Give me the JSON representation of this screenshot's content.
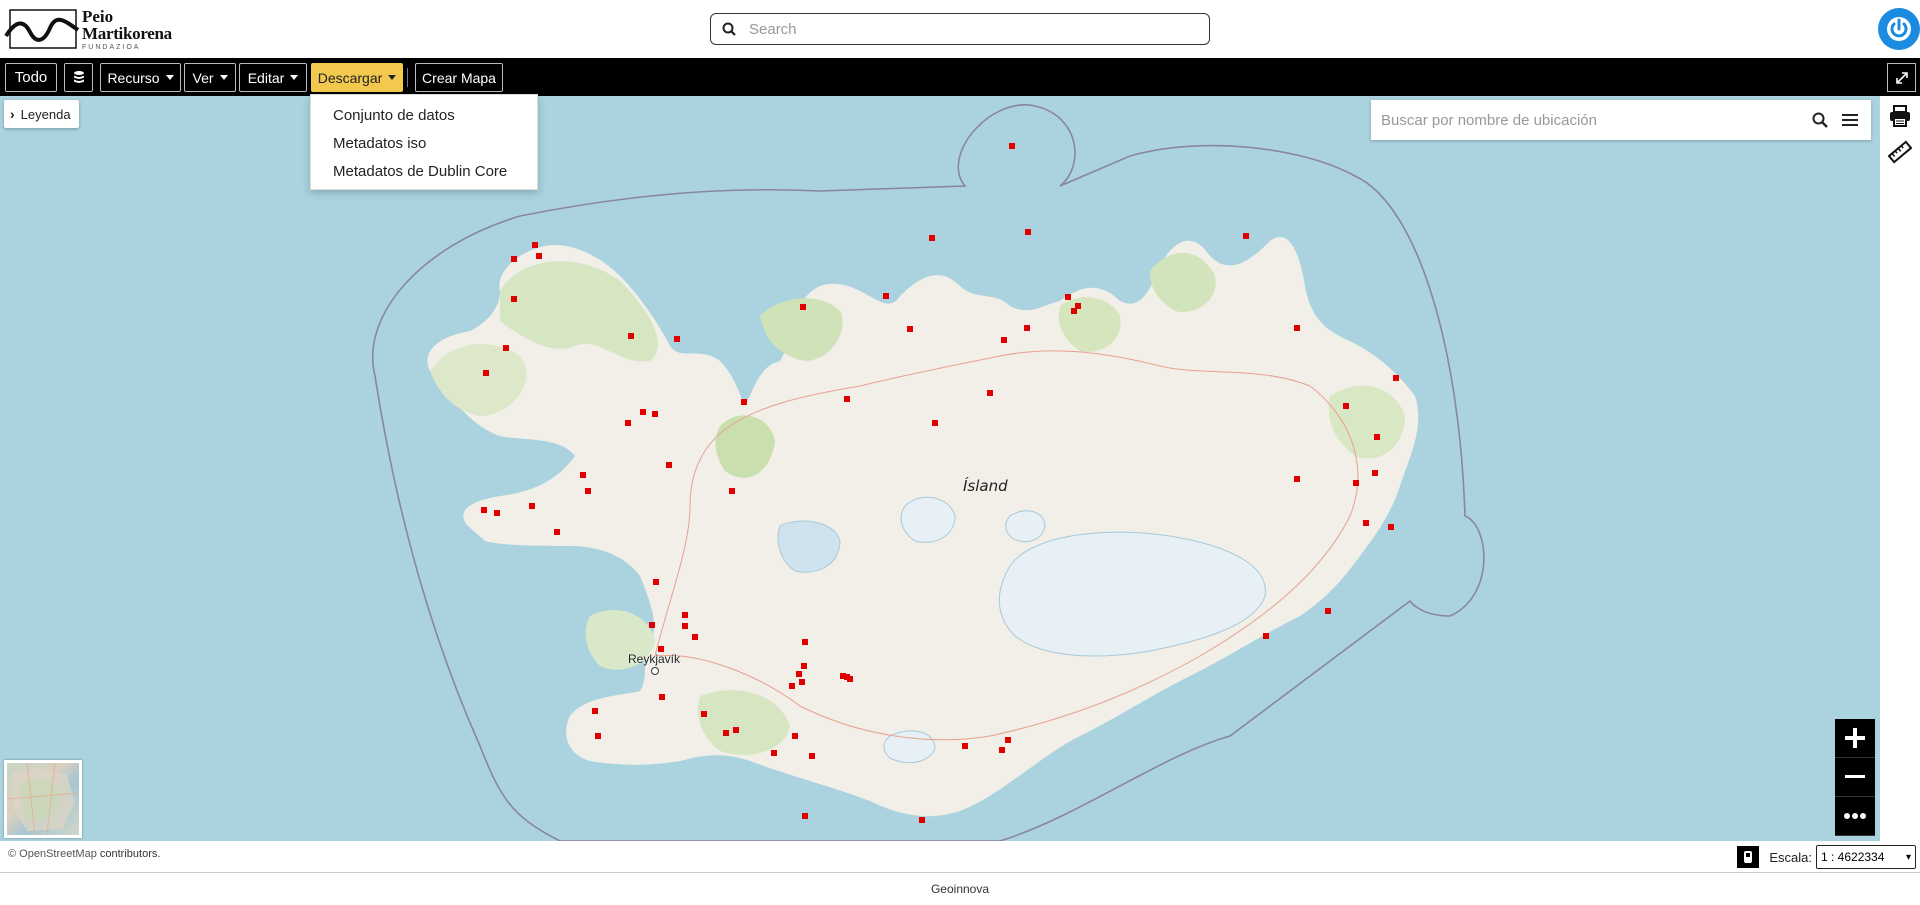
{
  "header": {
    "logo": {
      "line1": "Peio",
      "line2": "Martikorena",
      "line3": "FUNDAZIOA"
    },
    "search_placeholder": "Search",
    "power_icon": "power-icon",
    "brand_color": "#1a8be0"
  },
  "toolbar": {
    "todo": "Todo",
    "recurso": "Recurso",
    "ver": "Ver",
    "editar": "Editar",
    "descargar": "Descargar",
    "crear_mapa": "Crear Mapa",
    "active_color": "#f2c94c"
  },
  "download_menu": {
    "items": [
      "Conjunto de datos",
      "Metadatos iso",
      "Metadatos de Dublin Core"
    ]
  },
  "map": {
    "legend_label": "Leyenda",
    "location_search_placeholder": "Buscar por nombre de ubicación",
    "country_label": "Ísland",
    "city_label": "Reykjavík",
    "marker_color": "#e00000",
    "water_color": "#aad3df"
  },
  "attribution": {
    "osm": "© OpenStreetMap",
    "rest": " contributors."
  },
  "scale": {
    "label": "Escala:",
    "value": "1 : 4622334"
  },
  "footer": {
    "text": "Geoinnova"
  }
}
